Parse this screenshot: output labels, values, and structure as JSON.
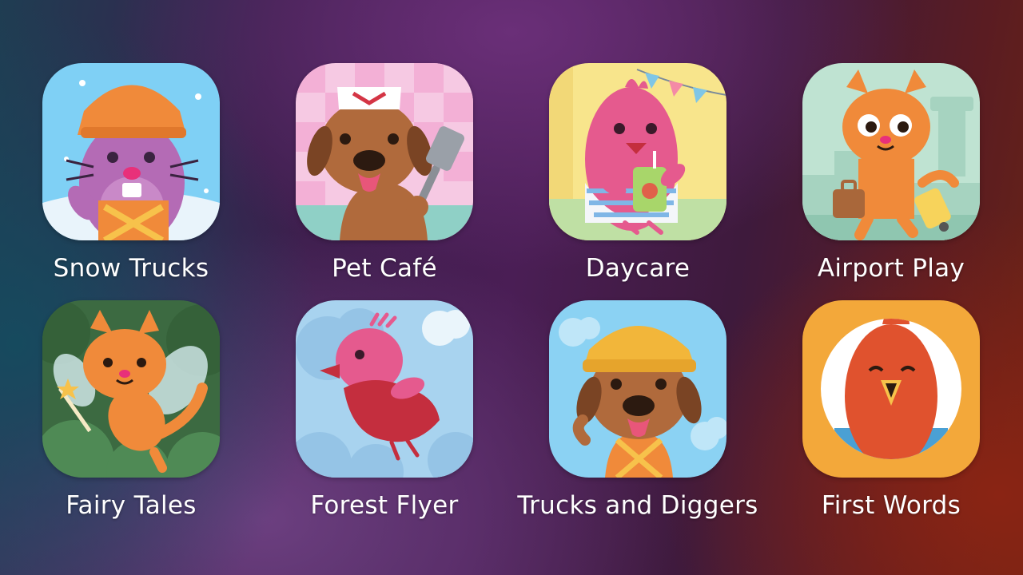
{
  "apps": [
    {
      "name": "Snow Trucks",
      "icon": "beaver-snow-trucks-icon"
    },
    {
      "name": "Pet Café",
      "icon": "dog-chef-pet-cafe-icon"
    },
    {
      "name": "Daycare",
      "icon": "bird-daycare-icon"
    },
    {
      "name": "Airport Play",
      "icon": "cat-airport-icon"
    },
    {
      "name": "Fairy Tales",
      "icon": "cat-fairy-icon"
    },
    {
      "name": "Forest Flyer",
      "icon": "red-bird-flyer-icon"
    },
    {
      "name": "Trucks and Diggers",
      "icon": "dog-builder-icon"
    },
    {
      "name": "First Words",
      "icon": "parrot-first-words-icon"
    }
  ],
  "colors": {
    "label": "#ffffff",
    "snow_bg": "#7fd0f5",
    "pet_cafe_bg": "#f6c9e3",
    "daycare_bg": "#f8e58c",
    "airport_bg": "#bfe3d2",
    "fairy_bg": "#3c6a41",
    "flyer_bg": "#a8d3ef",
    "trucks_bg": "#8bd2f3",
    "first_words_bg": "#f3a83a"
  }
}
